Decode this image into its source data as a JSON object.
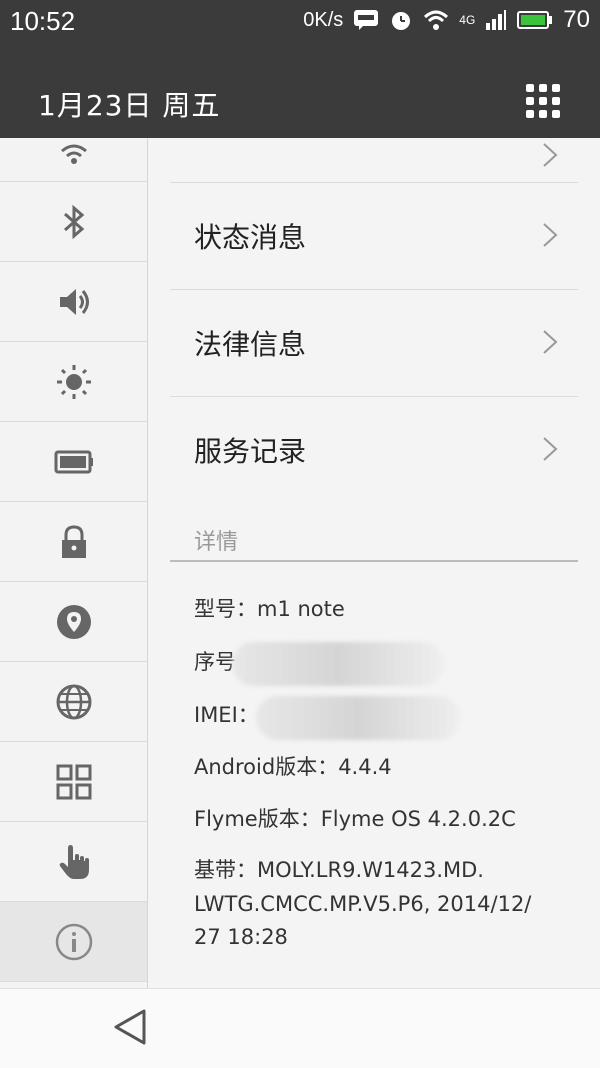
{
  "status": {
    "time": "10:52",
    "speed": "0K/s",
    "signal": "4G",
    "battery": "70"
  },
  "header": {
    "date": "1月23日  周五"
  },
  "sidebar": {
    "items": [
      {
        "icon": "wifi-icon"
      },
      {
        "icon": "bluetooth-icon"
      },
      {
        "icon": "volume-icon"
      },
      {
        "icon": "brightness-icon"
      },
      {
        "icon": "battery-icon"
      },
      {
        "icon": "lock-icon"
      },
      {
        "icon": "location-icon"
      },
      {
        "icon": "globe-icon"
      },
      {
        "icon": "apps-grid-icon"
      },
      {
        "icon": "gesture-hand-icon"
      },
      {
        "icon": "info-icon"
      }
    ]
  },
  "menu": {
    "items": [
      {
        "label": "状态消息"
      },
      {
        "label": "法律信息"
      },
      {
        "label": "服务记录"
      }
    ]
  },
  "details": {
    "title": "详情",
    "model": "型号：m1 note",
    "serial_label": "序号",
    "imei_label": "IMEI：",
    "android": "Android版本：4.4.4",
    "flyme": "Flyme版本：Flyme OS 4.2.0.2C",
    "baseband_line1": "基带：MOLY.LR9.W1423.MD.",
    "baseband_line2": "LWTG.CMCC.MP.V5.P6, 2014/12/",
    "baseband_line3": "27 18:28"
  }
}
